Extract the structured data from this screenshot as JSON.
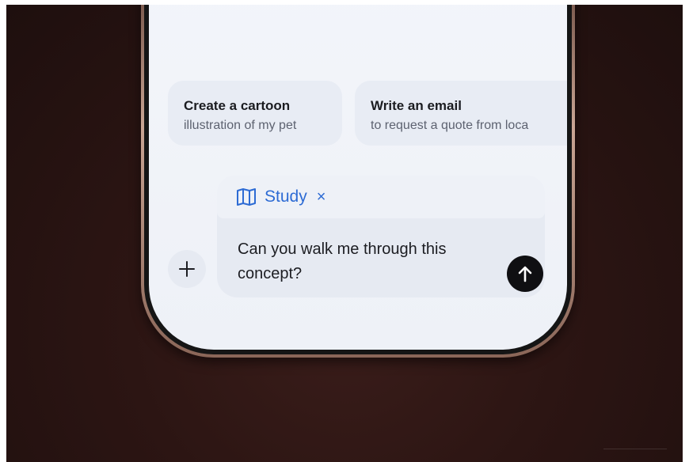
{
  "suggestions": [
    {
      "title": "Create a cartoon",
      "subtitle": "illustration of my pet"
    },
    {
      "title": "Write an email",
      "subtitle": "to request a quote from loca"
    }
  ],
  "composer": {
    "mode_chip": {
      "label": "Study",
      "icon": "book-icon",
      "remove": "×"
    },
    "message": "Can you walk me through this concept?",
    "send_icon": "arrow-up-icon",
    "add_icon": "plus-icon"
  },
  "colors": {
    "accent": "#2d6bd4",
    "send_bg": "#0f0f12",
    "screen_bg": "#f3f5fa",
    "card_bg": "#e8ecf4"
  }
}
